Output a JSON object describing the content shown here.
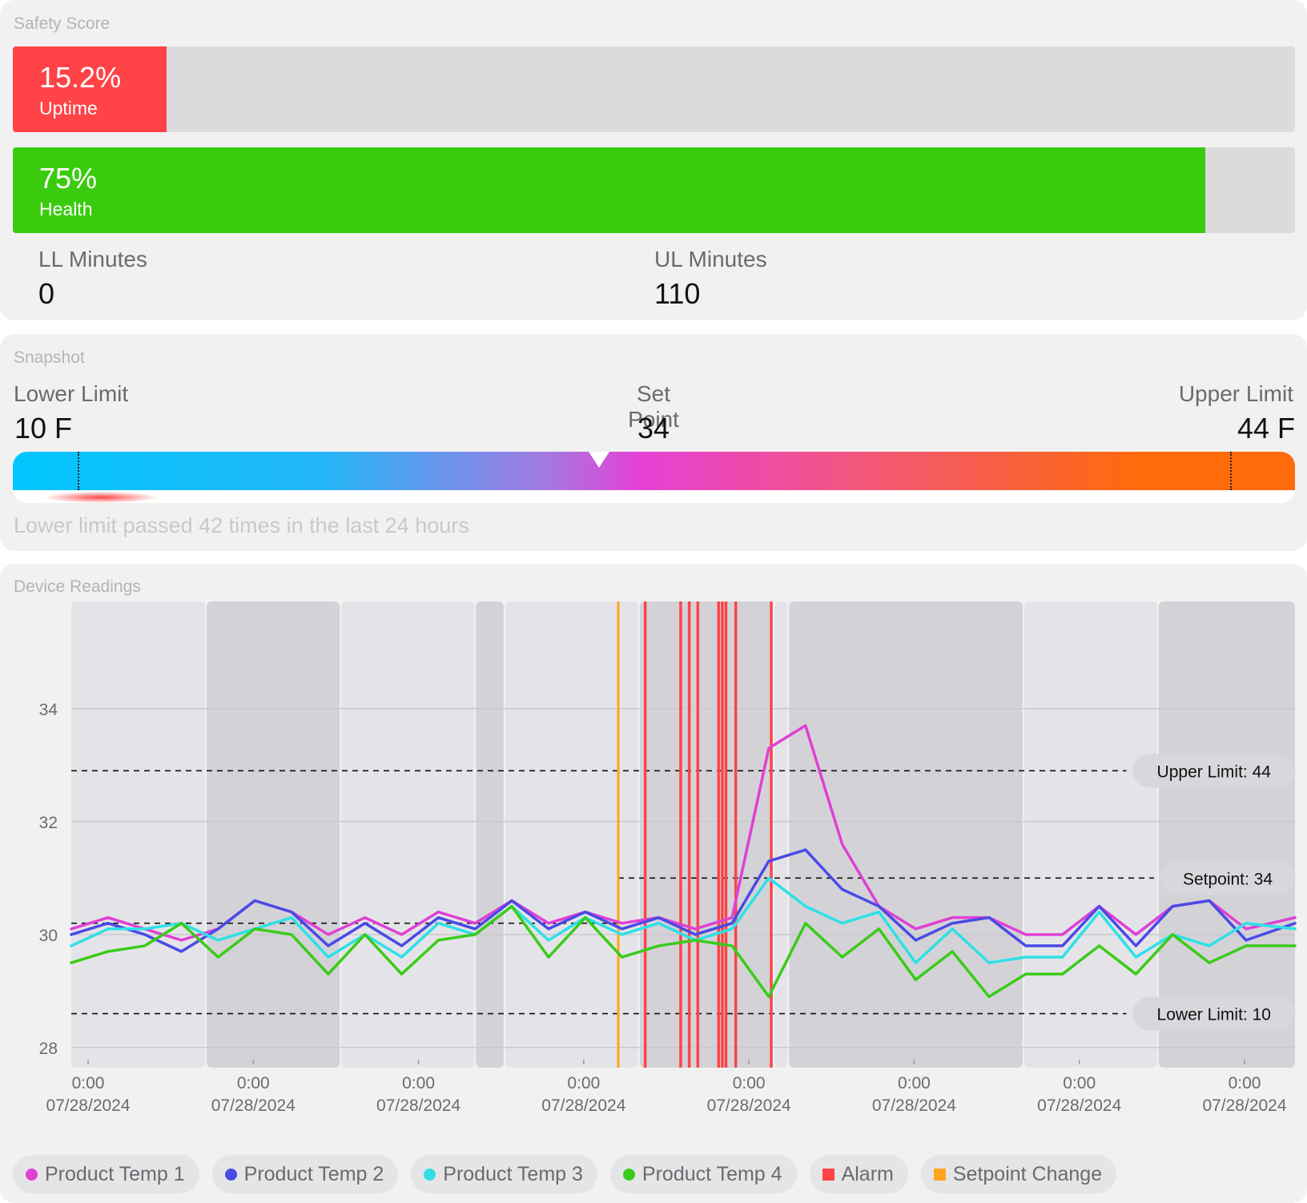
{
  "safety": {
    "title": "Safety Score",
    "uptime": {
      "value": "15.2%",
      "label": "Uptime",
      "fraction": 0.12,
      "color": "#ff4347"
    },
    "health": {
      "value": "75%",
      "label": "Health",
      "fraction": 0.93,
      "color": "#3acb0e"
    },
    "ll_minutes": {
      "label": "LL Minutes",
      "value": "0"
    },
    "ul_minutes": {
      "label": "UL Minutes",
      "value": "110"
    }
  },
  "snapshot": {
    "title": "Snapshot",
    "lower_limit": {
      "label": "Lower Limit",
      "value": "10 F"
    },
    "set_point": {
      "label": "Set Point",
      "value": "34"
    },
    "upper_limit": {
      "label": "Upper Limit",
      "value": "44 F"
    },
    "note": "Lower limit passed 42 times in the last 24 hours"
  },
  "readings": {
    "title": "Device Readings",
    "legend": [
      {
        "label": "Product Temp 1",
        "color": "#e040d4",
        "shape": "dot"
      },
      {
        "label": "Product Temp 2",
        "color": "#4a4ae6",
        "shape": "dot"
      },
      {
        "label": "Product Temp 3",
        "color": "#2ee0e6",
        "shape": "dot"
      },
      {
        "label": "Product Temp 4",
        "color": "#3acb1a",
        "shape": "dot"
      },
      {
        "label": "Alarm",
        "color": "#ff4347",
        "shape": "square"
      },
      {
        "label": "Setpoint Change",
        "color": "#ffa41c",
        "shape": "square"
      }
    ]
  },
  "chart_data": {
    "type": "line",
    "title": "",
    "xlabel": "",
    "ylabel": "",
    "ylim": [
      27.7,
      35.5
    ],
    "y_ticks": [
      "28",
      "30",
      "32",
      "34"
    ],
    "y_tick_values": [
      28,
      30,
      32,
      34
    ],
    "x_ticks": [
      {
        "time": "0:00",
        "date": "07/28/2024"
      },
      {
        "time": "0:00",
        "date": "07/28/2024"
      },
      {
        "time": "0:00",
        "date": "07/28/2024"
      },
      {
        "time": "0:00",
        "date": "07/28/2024"
      },
      {
        "time": "0:00",
        "date": "07/28/2024"
      },
      {
        "time": "0:00",
        "date": "07/28/2024"
      },
      {
        "time": "0:00",
        "date": "07/28/2024"
      },
      {
        "time": "0:00",
        "date": "07/28/2024"
      }
    ],
    "x_range": [
      0,
      1
    ],
    "x": [
      0,
      0.03,
      0.06,
      0.09,
      0.12,
      0.15,
      0.18,
      0.21,
      0.24,
      0.27,
      0.3,
      0.33,
      0.36,
      0.39,
      0.42,
      0.45,
      0.48,
      0.51,
      0.54,
      0.57,
      0.6,
      0.63,
      0.66,
      0.69,
      0.72,
      0.75,
      0.78,
      0.81,
      0.84,
      0.87,
      0.9,
      0.93,
      0.96,
      1.0
    ],
    "series": [
      {
        "name": "Product Temp 1",
        "color": "#e040d4",
        "values": [
          30.1,
          30.3,
          30.1,
          29.9,
          30.1,
          30.6,
          30.4,
          30.0,
          30.3,
          30.0,
          30.4,
          30.2,
          30.6,
          30.2,
          30.4,
          30.2,
          30.3,
          30.1,
          30.3,
          33.3,
          33.7,
          31.6,
          30.5,
          30.1,
          30.3,
          30.3,
          30.0,
          30.0,
          30.5,
          30.0,
          30.5,
          30.6,
          30.1,
          30.3
        ]
      },
      {
        "name": "Product Temp 2",
        "color": "#4a4ae6",
        "values": [
          30.0,
          30.2,
          30.0,
          29.7,
          30.1,
          30.6,
          30.4,
          29.8,
          30.2,
          29.8,
          30.3,
          30.1,
          30.6,
          30.1,
          30.4,
          30.1,
          30.3,
          30.0,
          30.2,
          31.3,
          31.5,
          30.8,
          30.5,
          29.9,
          30.2,
          30.3,
          29.8,
          29.8,
          30.5,
          29.8,
          30.5,
          30.6,
          29.9,
          30.2
        ]
      },
      {
        "name": "Product Temp 3",
        "color": "#2ee0e6",
        "values": [
          29.8,
          30.1,
          30.1,
          30.2,
          29.9,
          30.1,
          30.3,
          29.6,
          30.0,
          29.6,
          30.2,
          30.0,
          30.5,
          29.9,
          30.3,
          30.0,
          30.2,
          29.9,
          30.1,
          31.0,
          30.5,
          30.2,
          30.4,
          29.5,
          30.1,
          29.5,
          29.6,
          29.6,
          30.4,
          29.6,
          30.0,
          29.8,
          30.2,
          30.1
        ]
      },
      {
        "name": "Product Temp 4",
        "color": "#3acb1a",
        "values": [
          29.5,
          29.7,
          29.8,
          30.2,
          29.6,
          30.1,
          30.0,
          29.3,
          30.0,
          29.3,
          29.9,
          30.0,
          30.5,
          29.6,
          30.3,
          29.6,
          29.8,
          29.9,
          29.8,
          28.9,
          30.2,
          29.6,
          30.1,
          29.2,
          29.7,
          28.9,
          29.3,
          29.3,
          29.8,
          29.3,
          30.0,
          29.5,
          29.8,
          29.8
        ]
      }
    ],
    "reference_lines": [
      {
        "label": "Upper Limit: 44",
        "value": 32.9
      },
      {
        "label": "Setpoint: 34",
        "value": 31.0,
        "from_x": 0.447,
        "before_value": 30.2
      },
      {
        "label": "Lower Limit: 10",
        "value": 28.6
      }
    ],
    "setpoint_change_x": [
      0.447
    ],
    "alarm_x": [
      0.469,
      0.498,
      0.505,
      0.512,
      0.529,
      0.532,
      0.535,
      0.543,
      0.572
    ],
    "shaded_bands": [
      {
        "from": 0.0,
        "to": 0.11,
        "shade": "light"
      },
      {
        "from": 0.11,
        "to": 0.22,
        "shade": "dark"
      },
      {
        "from": 0.22,
        "to": 0.33,
        "shade": "light"
      },
      {
        "from": 0.33,
        "to": 0.354,
        "shade": "dark"
      },
      {
        "from": 0.354,
        "to": 0.464,
        "shade": "light"
      },
      {
        "from": 0.464,
        "to": 0.574,
        "shade": "dark"
      },
      {
        "from": 0.574,
        "to": 0.586,
        "shade": "light"
      },
      {
        "from": 0.586,
        "to": 0.778,
        "shade": "dark"
      },
      {
        "from": 0.778,
        "to": 0.888,
        "shade": "light"
      },
      {
        "from": 0.888,
        "to": 1.0,
        "shade": "dark"
      }
    ],
    "grid": true,
    "legend_position": "bottom"
  }
}
